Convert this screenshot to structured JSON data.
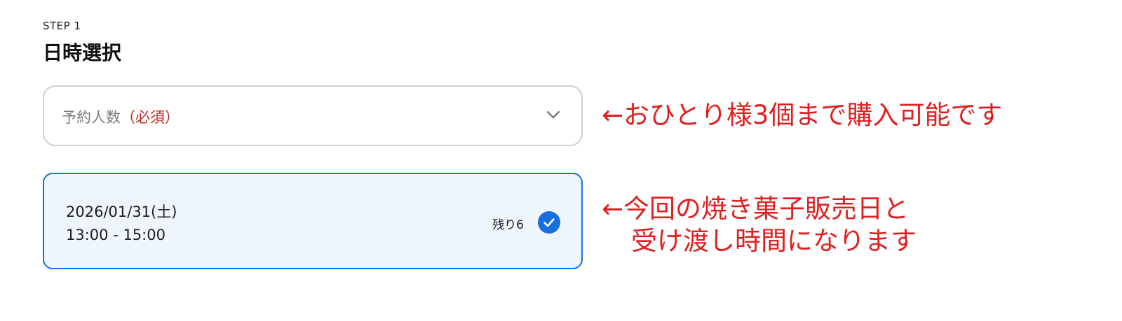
{
  "header": {
    "step": "STEP 1",
    "title": "日時選択"
  },
  "people_select": {
    "label": "予約人数",
    "required": "（必須）",
    "icon": "chevron-down-icon"
  },
  "slot": {
    "date": "2026/01/31(土)",
    "time": "13:00 - 15:00",
    "remaining": "残り6",
    "selected": true,
    "icon": "check-circle-icon"
  },
  "annotations": {
    "people_note": "←おひとり様3個まで購入可能です",
    "slot_note_line1": "←今回の焼き菓子販売日と",
    "slot_note_line2": "受け渡し時間になります"
  },
  "colors": {
    "accent": "#1a6fe0",
    "selected_bg": "#eef5fd",
    "required_red": "#c0261f",
    "annotation_red": "#e02020"
  }
}
